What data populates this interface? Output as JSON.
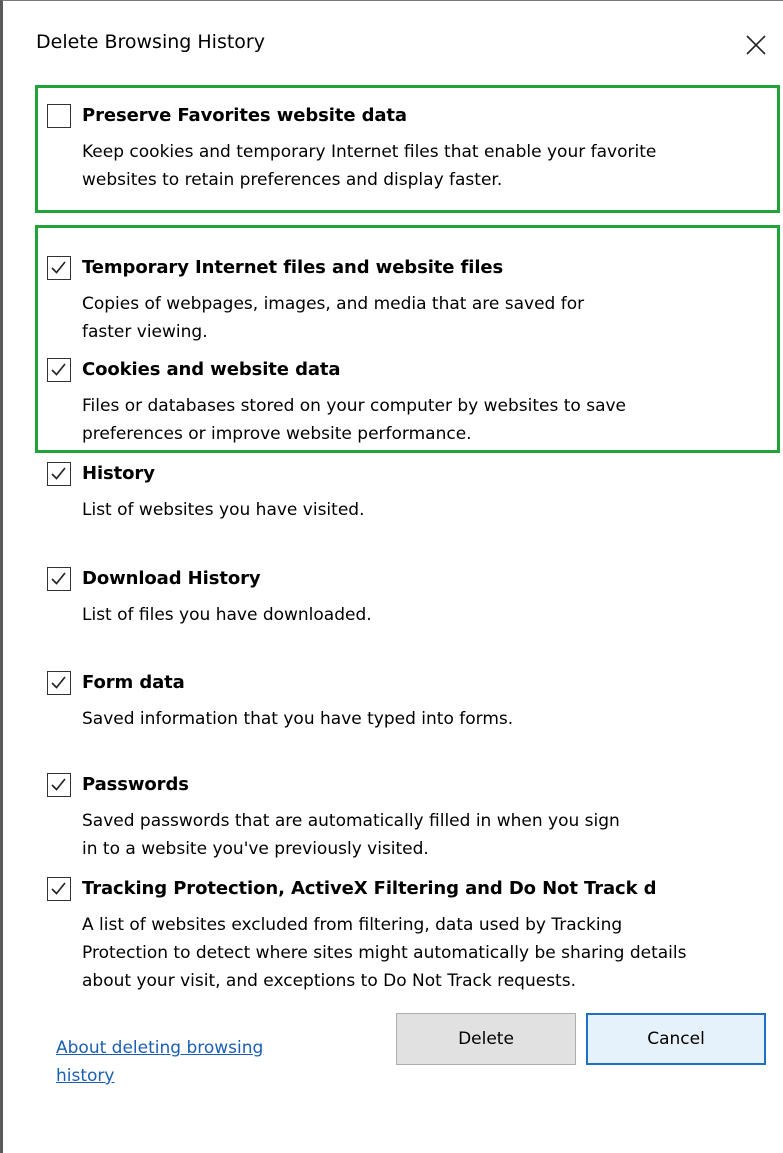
{
  "window": {
    "title": "Delete Browsing History",
    "close_icon": "close-icon"
  },
  "colors": {
    "highlight_border": "#22a339",
    "link": "#1a5fb4",
    "primary_button_border": "#1f6fc4"
  },
  "items": [
    {
      "title": "Preserve Favorites website data",
      "description": "Keep cookies and temporary Internet files that enable your favorite\nwebsites to retain preferences and display faster.",
      "checked": false
    },
    {
      "title": "Temporary Internet files and website files",
      "description": "Copies of webpages, images, and media that are saved for\nfaster viewing.",
      "checked": true
    },
    {
      "title": "Cookies and website data",
      "description": "Files or databases stored on your computer by websites to save\npreferences or improve website performance.",
      "checked": true
    },
    {
      "title": "History",
      "description": "List of websites you have visited.",
      "checked": true
    },
    {
      "title": "Download History",
      "description": "List of files you have downloaded.",
      "checked": true
    },
    {
      "title": "Form data",
      "description": "Saved information that you have typed into forms.",
      "checked": true
    },
    {
      "title": "Passwords",
      "description": "Saved passwords that are automatically filled in when you sign\nin to a website you've previously visited.",
      "checked": true
    },
    {
      "title": "Tracking Protection, ActiveX Filtering and Do Not Track d",
      "description": "A list of websites excluded from filtering, data used by Tracking\nProtection to detect where sites might automatically be sharing details\nabout your visit, and exceptions to Do Not Track requests.",
      "checked": true
    }
  ],
  "footer": {
    "help_link": "About deleting browsing history",
    "delete_label": "Delete",
    "cancel_label": "Cancel"
  }
}
